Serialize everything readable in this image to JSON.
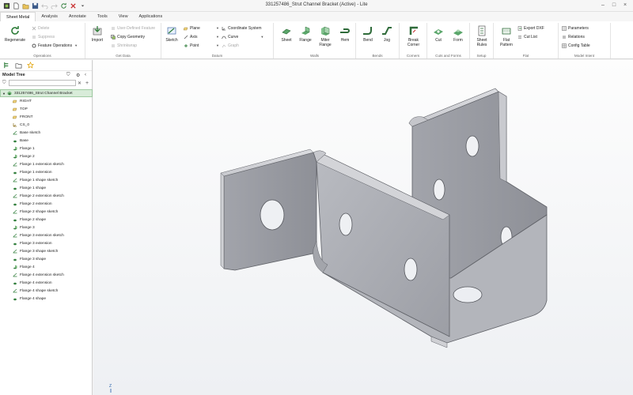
{
  "window": {
    "title": "331257486_Strut Channel Bracket (Active) - Lite",
    "controls": [
      "–",
      "□",
      "×"
    ]
  },
  "tabs": [
    "Sheet Metal",
    "Analysis",
    "Annotate",
    "Tools",
    "View",
    "Applications"
  ],
  "ribbon": {
    "operations": {
      "label": "Operations",
      "regenerate": "Regenerate",
      "delete": "Delete",
      "suppress": "Suppress",
      "feature_operations": "Feature Operations"
    },
    "get_data": {
      "label": "Get Data",
      "import": "Import",
      "user_defined_feature": "User-Defined Feature",
      "copy_geometry": "Copy Geometry",
      "shrinkwrap": "Shrinkwrap"
    },
    "datum": {
      "label": "Datum",
      "sketch": "Sketch",
      "plane": "Plane",
      "axis": "Axis",
      "point": "Point",
      "coordinate_system": "Coordinate System",
      "curve": "Curve",
      "graph": "Graph"
    },
    "walls": {
      "label": "Walls",
      "sheet": "Sheet",
      "flange": "Flange",
      "miter_flange": "Miter Flange",
      "hem": "Hem"
    },
    "bends": {
      "label": "Bends",
      "bend": "Bend",
      "jog": "Jog"
    },
    "corners": {
      "label": "Corners",
      "break_corner": "Break Corner"
    },
    "cuts_forms": {
      "label": "Cuts and Forms",
      "cut": "Cut",
      "form": "Form"
    },
    "setup": {
      "label": "Setup",
      "sheet_rules": "Sheet Rules"
    },
    "flat": {
      "label": "Flat",
      "flat_pattern": "Flat Pattern",
      "export_dxf": "Export DXF",
      "cut_list": "Cut List"
    },
    "model_intent": {
      "label": "Model Intent",
      "parameters": "Parameters",
      "relations": "Relations",
      "config_table": "Config Table"
    }
  },
  "model_tree": {
    "title": "Model Tree",
    "search_placeholder": "",
    "root": "331257486_Strut Channel Bracket",
    "items": [
      {
        "label": "RIGHT",
        "icon": "datum-plane-icon"
      },
      {
        "label": "TOP",
        "icon": "datum-plane-icon"
      },
      {
        "label": "FRONT",
        "icon": "datum-plane-icon"
      },
      {
        "label": "CS_0",
        "icon": "coordinate-system-icon"
      },
      {
        "label": "Base sketch",
        "icon": "sketch-icon"
      },
      {
        "label": "Base",
        "icon": "sheet-icon"
      },
      {
        "label": "Flange 1",
        "icon": "flange-icon"
      },
      {
        "label": "Flange 2",
        "icon": "flange-icon"
      },
      {
        "label": "Flange 1 extension sketch",
        "icon": "sketch-icon"
      },
      {
        "label": "Flange 1 extension",
        "icon": "sheet-icon"
      },
      {
        "label": "Flange 1 shape sketch",
        "icon": "sketch-icon"
      },
      {
        "label": "Flange 1 shape",
        "icon": "sheet-icon"
      },
      {
        "label": "Flange 2 extension sketch",
        "icon": "sketch-icon"
      },
      {
        "label": "Flange 2 extension",
        "icon": "sheet-icon"
      },
      {
        "label": "Flange 2 shape sketch",
        "icon": "sketch-icon"
      },
      {
        "label": "Flange 2 shape",
        "icon": "sheet-icon"
      },
      {
        "label": "Flange 3",
        "icon": "flange-icon"
      },
      {
        "label": "Flange 3 extension sketch",
        "icon": "sketch-icon"
      },
      {
        "label": "Flange 3 extension",
        "icon": "sheet-icon"
      },
      {
        "label": "Flange 3 shape sketch",
        "icon": "sketch-icon"
      },
      {
        "label": "Flange 3 shape",
        "icon": "sheet-icon"
      },
      {
        "label": "Flange 4",
        "icon": "flange-icon"
      },
      {
        "label": "Flange 4 extension sketch",
        "icon": "sketch-icon"
      },
      {
        "label": "Flange 4 extension",
        "icon": "sheet-icon"
      },
      {
        "label": "Flange 4 shape sketch",
        "icon": "sketch-icon"
      },
      {
        "label": "Flange 4 shape",
        "icon": "sheet-icon"
      }
    ]
  },
  "viewport": {
    "triad_label": "Z"
  },
  "colors": {
    "accent_green": "#2f7d3a",
    "tree_select": "#d8ecd9",
    "part_gray": "#a8aab0"
  }
}
